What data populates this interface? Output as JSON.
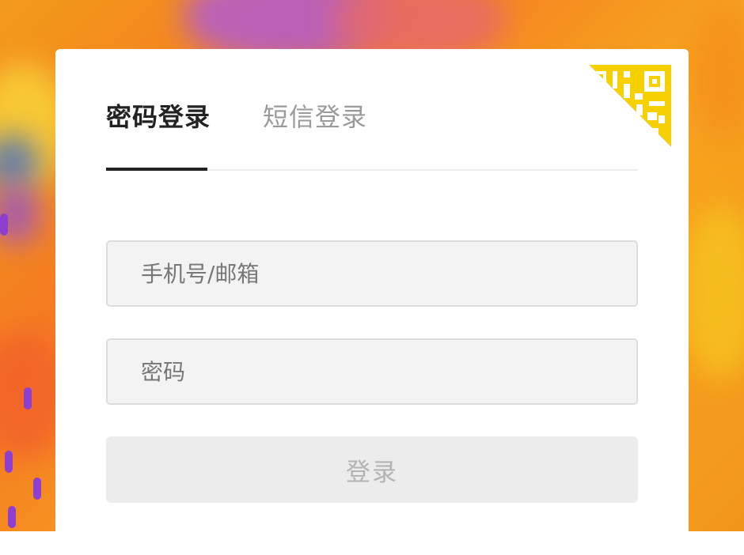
{
  "colors": {
    "accent_yellow": "#f7d000",
    "background_orange": "#f39a1a",
    "tab_active": "#222222",
    "tab_inactive": "#9a9a9a"
  },
  "tabs": [
    {
      "label": "密码登录",
      "active": true
    },
    {
      "label": "短信登录",
      "active": false
    }
  ],
  "form": {
    "account_placeholder": "手机号/邮箱",
    "password_placeholder": "密码",
    "submit_label": "登录"
  },
  "icons": {
    "corner": "qr-code-icon"
  }
}
